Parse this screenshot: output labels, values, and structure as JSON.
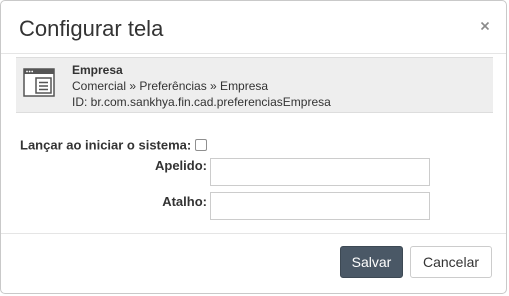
{
  "dialog": {
    "title": "Configurar tela",
    "close_label": "×"
  },
  "info": {
    "icon": "screen-window-icon",
    "name": "Empresa",
    "path": "Comercial » Preferências » Empresa",
    "id": "ID: br.com.sankhya.fin.cad.preferenciasEmpresa"
  },
  "form": {
    "launch_label": "Lançar ao iniciar o sistema:",
    "launch_checked": false,
    "apelido_label": "Apelido:",
    "apelido_value": "",
    "atalho_label": "Atalho:",
    "atalho_value": ""
  },
  "footer": {
    "save_label": "Salvar",
    "cancel_label": "Cancelar"
  },
  "colors": {
    "save_button_bg": "#4a5866",
    "info_box_bg": "#eeeeee"
  }
}
